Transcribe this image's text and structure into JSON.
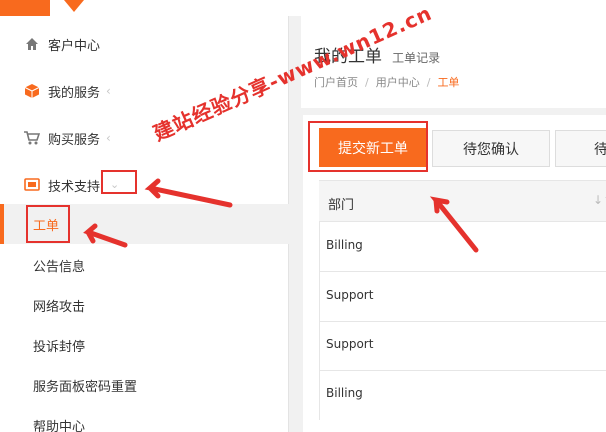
{
  "sidebar": {
    "items": [
      {
        "label": "客户中心",
        "icon": "home-icon"
      },
      {
        "label": "我的服务",
        "icon": "cube-icon"
      },
      {
        "label": "购买服务",
        "icon": "cart-icon"
      },
      {
        "label": "技术支持",
        "icon": "support-icon"
      }
    ],
    "sub_items": [
      {
        "label": "工单",
        "active": true
      },
      {
        "label": "公告信息"
      },
      {
        "label": "网络攻击"
      },
      {
        "label": "投诉封停"
      },
      {
        "label": "服务面板密码重置"
      },
      {
        "label": "帮助中心"
      }
    ]
  },
  "main": {
    "title": "我的工单",
    "subtitle": "工单记录",
    "breadcrumb": [
      "门户首页",
      "用户中心",
      "工单"
    ],
    "tabs": [
      "提交新工单",
      "待您确认",
      "待"
    ],
    "table": {
      "header": "部门",
      "rows": [
        "Billing",
        "Support",
        "Support",
        "Billing"
      ]
    }
  },
  "watermark": "建站经验分享-www.wn12.cn",
  "colors": {
    "accent": "#f86a1e",
    "annotation": "#e5322d"
  }
}
